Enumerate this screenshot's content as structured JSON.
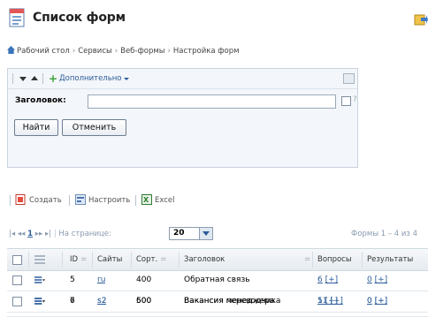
{
  "header": {
    "title": "Список форм",
    "icons": {
      "title": "forms-list-icon",
      "corner": "export-icon"
    }
  },
  "breadcrumb": [
    "Рабочий стол",
    "Сервисы",
    "Веб-формы",
    "Настройка форм"
  ],
  "filter": {
    "more_label": "Дополнительно",
    "field_label": "Заголовок:",
    "field_value": "",
    "help": "?",
    "find_button": "Найти",
    "cancel_button": "Отменить"
  },
  "grid_toolbar": {
    "create": "Создать",
    "settings": "Настроить",
    "excel": "Excel"
  },
  "pager": {
    "nav_first": "|◂",
    "nav_prev": "◂◂",
    "current_page": "1",
    "nav_next": "▸▸",
    "nav_last": "▸|",
    "per_page_label": "На странице:",
    "per_page_value": "20",
    "info": "Формы 1 – 4 из 4"
  },
  "table": {
    "columns": [
      "ID",
      "Сайты",
      "Сорт.",
      "Заголовок",
      "Вопросы",
      "Результаты"
    ],
    "rows": [
      {
        "id": "5",
        "site": "ru",
        "sort": "400",
        "title": "Обратная связь",
        "questions": "6",
        "q_plus": "[+]",
        "results": "0",
        "r_plus": "[+]"
      },
      {
        "id": "6",
        "site": "s2",
        "sort": "500",
        "title": "Вакансия переводчика",
        "questions": "5",
        "q_plus": "[+]",
        "results": "0",
        "r_plus": "[+]"
      },
      {
        "id": "7",
        "site": "s2",
        "sort": "600",
        "title": "Вакансия менеджера",
        "questions": "11",
        "q_plus": "[+]",
        "results": "0",
        "r_plus": "[+]"
      }
    ]
  },
  "colors": {
    "link": "#2a5c9a",
    "accent_green": "#3aa23a",
    "border": "#c8d3df"
  }
}
